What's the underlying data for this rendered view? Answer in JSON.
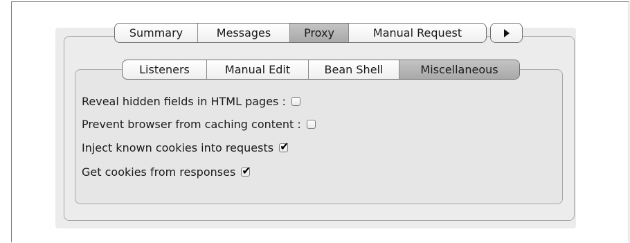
{
  "tabs": {
    "top": [
      {
        "label": "Summary",
        "selected": false
      },
      {
        "label": "Messages",
        "selected": false
      },
      {
        "label": "Proxy",
        "selected": true
      },
      {
        "label": "Manual Request",
        "selected": false
      }
    ],
    "sub": [
      {
        "label": "Listeners",
        "selected": false
      },
      {
        "label": "Manual Edit",
        "selected": false
      },
      {
        "label": "Bean Shell",
        "selected": false
      },
      {
        "label": "Miscellaneous",
        "selected": true
      }
    ]
  },
  "options": [
    {
      "label": "Reveal hidden fields in HTML pages :",
      "checked": false
    },
    {
      "label": "Prevent browser from caching content :",
      "checked": false
    },
    {
      "label": "Inject known cookies into requests",
      "checked": true
    },
    {
      "label": "Get cookies from responses",
      "checked": true
    }
  ],
  "icons": {
    "more_tabs": "play-triangle-icon"
  }
}
